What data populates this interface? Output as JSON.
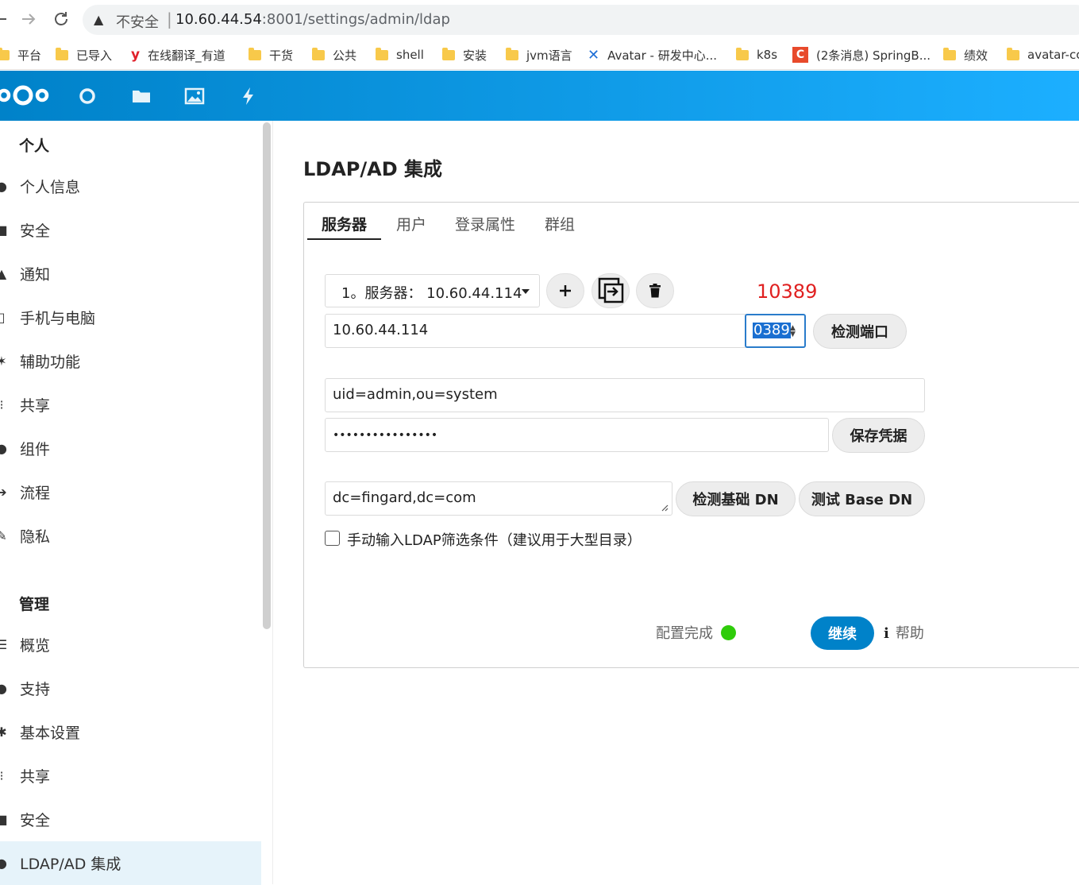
{
  "browser": {
    "back_icon": "back-arrow-icon",
    "forward": "→",
    "reload": "↻",
    "warn_symbol": "▲",
    "insecure_label": "不安全",
    "separator": "|",
    "url_host": "10.60.44.54",
    "url_path": ":8001/settings/admin/ldap"
  },
  "bookmarks": [
    {
      "label": "平台",
      "icon": "folder-icon"
    },
    {
      "label": "已导入",
      "icon": "folder-icon"
    },
    {
      "label": "在线翻译_有道",
      "icon": "youdao-icon",
      "glyph": "y"
    },
    {
      "label": "干货",
      "icon": "folder-icon"
    },
    {
      "label": "公共",
      "icon": "folder-icon"
    },
    {
      "label": "shell",
      "icon": "folder-icon"
    },
    {
      "label": "安装",
      "icon": "folder-icon"
    },
    {
      "label": "jvm语言",
      "icon": "folder-icon"
    },
    {
      "label": "Avatar - 研发中心...",
      "icon": "confluence-icon",
      "glyph": "✕"
    },
    {
      "label": "k8s",
      "icon": "folder-icon"
    },
    {
      "label": "(2条消息) SpringB...",
      "icon": "csdn-icon",
      "glyph": "C"
    },
    {
      "label": "绩效",
      "icon": "folder-icon"
    },
    {
      "label": "avatar-cc",
      "icon": "folder-icon"
    }
  ],
  "sidebar": {
    "personal_heading": "个人",
    "personal_items": [
      {
        "label": "个人信息",
        "icon": "user-icon",
        "glyph": "●"
      },
      {
        "label": "安全",
        "icon": "lock-icon",
        "glyph": "■"
      },
      {
        "label": "通知",
        "icon": "bell-icon",
        "glyph": "▲"
      },
      {
        "label": "手机与电脑",
        "icon": "devices-icon",
        "glyph": "▯"
      },
      {
        "label": "辅助功能",
        "icon": "accessibility-icon",
        "glyph": "✶"
      },
      {
        "label": "共享",
        "icon": "share-icon",
        "glyph": "⁝"
      },
      {
        "label": "组件",
        "icon": "group-icon",
        "glyph": "●"
      },
      {
        "label": "流程",
        "icon": "flow-icon",
        "glyph": "➔"
      },
      {
        "label": "隐私",
        "icon": "privacy-icon",
        "glyph": "✎"
      }
    ],
    "admin_heading": "管理",
    "admin_items": [
      {
        "label": "概览",
        "icon": "list-icon",
        "glyph": "☰"
      },
      {
        "label": "支持",
        "icon": "support-icon",
        "glyph": "●"
      },
      {
        "label": "基本设置",
        "icon": "settings-icon",
        "glyph": "✱"
      },
      {
        "label": "共享",
        "icon": "share-icon",
        "glyph": "⁝"
      },
      {
        "label": "安全",
        "icon": "lock-icon",
        "glyph": "■"
      },
      {
        "label": "LDAP/AD 集成",
        "icon": "ldap-user-icon",
        "glyph": "●",
        "active": true
      }
    ]
  },
  "main": {
    "title": "LDAP/AD 集成",
    "tabs": [
      "服务器",
      "用户",
      "登录属性",
      "群组"
    ],
    "active_tab": "服务器",
    "server_select": "1。服务器：  10.60.44.114",
    "annotation": "10389",
    "host_value": "10.60.44.114",
    "port_value": "0389",
    "detect_port_label": "检测端口",
    "user_dn_value": "uid=admin,ou=system",
    "password_mask": "••••••••••••••••",
    "save_credentials_label": "保存凭据",
    "base_dn_value": "dc=fingard,dc=com",
    "detect_base_dn_label": "检测基础 DN",
    "test_base_dn_label": "测试 Base DN",
    "manual_filter_label": "手动输入LDAP筛选条件（建议用于大型目录）",
    "config_status": "配置完成",
    "continue_label": "继续",
    "help_icon": "i",
    "help_label": "帮助",
    "status_color": "#2fcc0a",
    "accent_color": "#0082c9"
  }
}
